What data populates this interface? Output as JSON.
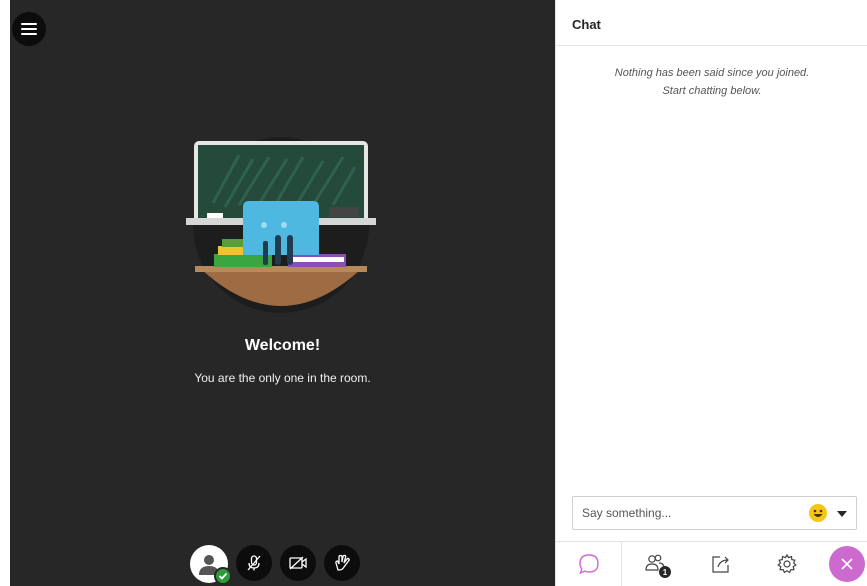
{
  "stage": {
    "welcome_title": "Welcome!",
    "welcome_subtitle": "You are the only one in the room.",
    "menu_icon": "hamburger-menu-icon"
  },
  "controls": {
    "items": [
      "avatar-status",
      "microphone-off",
      "camera-off",
      "raise-hand"
    ]
  },
  "chat": {
    "title": "Chat",
    "empty_line1": "Nothing has been said since you joined.",
    "empty_line2": "Start chatting below.",
    "input_placeholder": "Say something...",
    "emoji_icon": "smiley-emoji-icon"
  },
  "tabs": {
    "attendee_count": "1",
    "items": [
      "chat",
      "attendees",
      "share-content",
      "settings"
    ]
  },
  "colors": {
    "stage_bg": "#272727",
    "accent_purple": "#cc6ad0",
    "status_green": "#2d9a3a",
    "emoji_yellow": "#f5c518"
  }
}
